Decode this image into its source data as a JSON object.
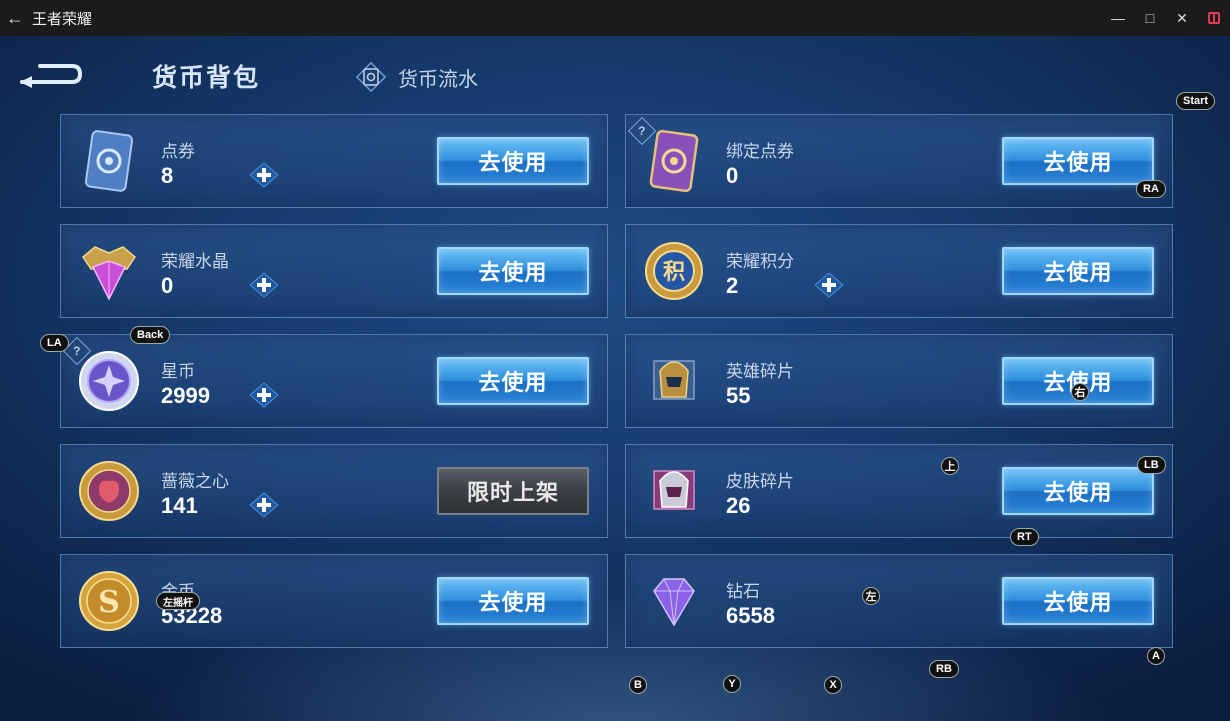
{
  "window": {
    "title": "王者荣耀"
  },
  "tabs": {
    "wallet": "货币背包",
    "flow": "货币流水"
  },
  "use_label": "去使用",
  "limited_label": "限时上架",
  "currencies": [
    {
      "name": "点券",
      "count": "8",
      "icon": "voucher-card-icon",
      "plus": true,
      "action": "use"
    },
    {
      "name": "绑定点券",
      "count": "0",
      "icon": "bound-voucher-card-icon",
      "plus": false,
      "action": "use",
      "help": true
    },
    {
      "name": "荣耀水晶",
      "count": "0",
      "icon": "glory-crystal-icon",
      "plus": true,
      "action": "use"
    },
    {
      "name": "荣耀积分",
      "count": "2",
      "icon": "glory-points-icon",
      "plus": true,
      "action": "use"
    },
    {
      "name": "星币",
      "count": "2999",
      "icon": "star-coin-icon",
      "plus": true,
      "action": "use",
      "help": true
    },
    {
      "name": "英雄碎片",
      "count": "55",
      "icon": "hero-fragment-icon",
      "plus": false,
      "action": "use"
    },
    {
      "name": "蔷薇之心",
      "count": "141",
      "icon": "rose-heart-icon",
      "plus": true,
      "action": "limited"
    },
    {
      "name": "皮肤碎片",
      "count": "26",
      "icon": "skin-fragment-icon",
      "plus": false,
      "action": "use"
    },
    {
      "name": "金币",
      "count": "53228",
      "icon": "gold-coin-icon",
      "plus": false,
      "action": "use"
    },
    {
      "name": "钻石",
      "count": "6558",
      "icon": "diamond-icon",
      "plus": false,
      "action": "use"
    }
  ],
  "controller_hints": {
    "start": "Start",
    "ra": "RA",
    "la": "LA",
    "back": "Back",
    "right": "右",
    "up": "上",
    "lb": "LB",
    "rt": "RT",
    "left_stick": "左摇杆",
    "left": "左",
    "a": "A",
    "rb": "RB",
    "b": "B",
    "y": "Y",
    "x": "X"
  },
  "colors": {
    "accent_blue": "#2e8fdc",
    "panel_border": "#78aae1",
    "background": "#163a6c"
  }
}
